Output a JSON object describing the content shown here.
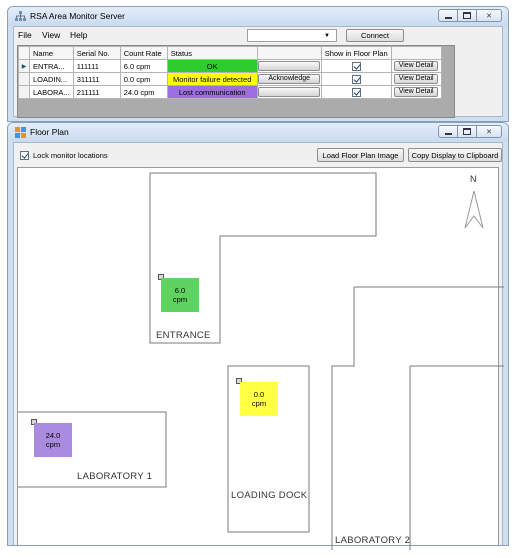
{
  "main_window": {
    "title": "RSA Area Monitor Server",
    "menu": [
      "File",
      "View",
      "Help"
    ],
    "connection_select_value": "",
    "connect_label": "Connect",
    "grid": {
      "columns": [
        "Name",
        "Serial No.",
        "Count Rate",
        "Status",
        "",
        "Show in Floor Plan",
        ""
      ],
      "rows": [
        {
          "name": "ENTRA...",
          "serial": "111111",
          "rate": "6.0 cpm",
          "status": "OK",
          "status_color": "#2ecc2e",
          "ack_label": "",
          "show": true,
          "detail_label": "View Detail",
          "current": true
        },
        {
          "name": "LOADIN...",
          "serial": "311111",
          "rate": "0.0 cpm",
          "status": "Monitor failure detected",
          "status_color": "#ffff00",
          "ack_label": "Acknowledge",
          "show": true,
          "detail_label": "View Detail",
          "current": false
        },
        {
          "name": "LABORA...",
          "serial": "211111",
          "rate": "24.0 cpm",
          "status": "Lost communication",
          "status_color": "#9b6fe0",
          "ack_label": "",
          "show": true,
          "detail_label": "View Detail",
          "current": false
        }
      ]
    }
  },
  "floor_plan_window": {
    "title": "Floor Plan",
    "lock_label": "Lock monitor locations",
    "lock_checked": true,
    "load_button": "Load Floor Plan Image",
    "copy_button": "Copy Display to Clipboard",
    "north_label": "N",
    "rooms": {
      "entrance": "ENTRANCE",
      "loading_dock": "LOADING DOCK",
      "lab1": "LABORATORY 1",
      "lab2": "LABORATORY 2"
    },
    "monitors": {
      "entrance": {
        "value": "6.0",
        "unit": "cpm",
        "color": "#5fd35f"
      },
      "loading": {
        "value": "0.0",
        "unit": "cpm",
        "color": "#ffff44"
      },
      "lab": {
        "value": "24.0",
        "unit": "cpm",
        "color": "#a98be0"
      }
    }
  },
  "colors": {
    "titlebar": "#cfdff0",
    "client": "#f0f0f0"
  }
}
